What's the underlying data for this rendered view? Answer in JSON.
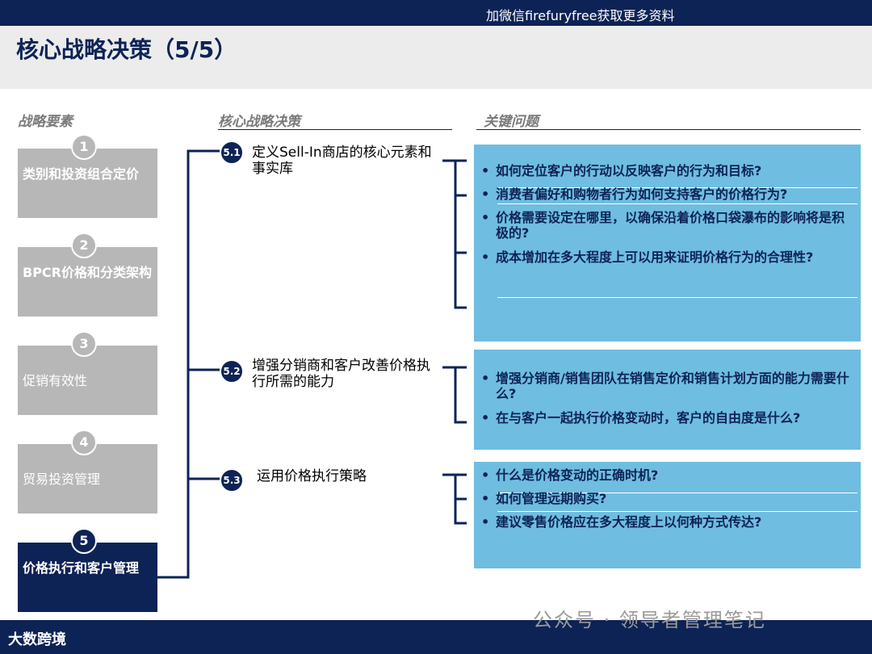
{
  "header": {
    "note": "加微信firefuryfree获取更多资料",
    "title": "核心战略决策（5/5）"
  },
  "columns": {
    "elements": "战略要素",
    "decisions": "核心战略决策",
    "questions": "关键问题"
  },
  "strategy_elements": [
    {
      "num": "1",
      "label": "类别和投资组合定价"
    },
    {
      "num": "2",
      "label": "BPCR价格和分类架构"
    },
    {
      "num": "3",
      "label": "促销有效性"
    },
    {
      "num": "4",
      "label": "贸易投资管理"
    },
    {
      "num": "5",
      "label": "价格执行和客户管理"
    }
  ],
  "decisions": [
    {
      "num": "5.1",
      "text": "定义Sell-In商店的核心元素和事实库"
    },
    {
      "num": "5.2",
      "text": "增强分销商和客户改善价格执行所需的能力"
    },
    {
      "num": "5.3",
      "text": "运用价格执行策略"
    }
  ],
  "questions": [
    [
      "如何定位客户的行动以反映客户的行为和目标?",
      "消费者偏好和购物者行为如何支持客户的价格行为?",
      "价格需要设定在哪里，以确保沿着价格口袋瀑布的影响将是积极的?",
      "成本增加在多大程度上可以用来证明价格行为的合理性?"
    ],
    [
      "增强分销商/销售团队在销售定价和销售计划方面的能力需要什么?",
      "在与客户一起执行价格变动时，客户的自由度是什么?"
    ],
    [
      "什么是价格变动的正确时机?",
      "如何管理远期购买?",
      "建议零售价格应在多大程度上以何种方式传达?"
    ]
  ],
  "footer": {
    "logo": "大数跨境",
    "watermark": "公众号 · 领导者管理笔记"
  },
  "colors": {
    "navy": "#0d2356",
    "gray": "#b7b7b7",
    "blue": "#6fbde0"
  }
}
